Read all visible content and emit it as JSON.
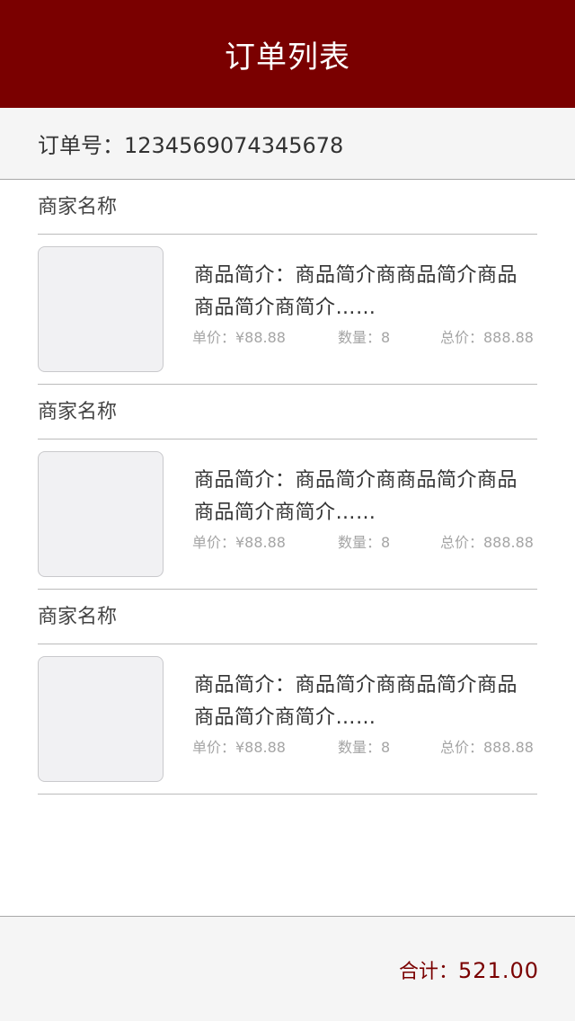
{
  "header": {
    "title": "订单列表"
  },
  "order": {
    "number_label": "订单号：1234569074345678"
  },
  "stores": [
    {
      "merchant_name": "商家名称",
      "description_line1": "商品简介：商品简介商商品简介商品",
      "description_line2": "商品简介商简介……",
      "unit_price": "单价：¥88.88",
      "quantity": "数量：8",
      "total_price": "总价：888.88"
    },
    {
      "merchant_name": "商家名称",
      "description_line1": "商品简介：商品简介商商品简介商品",
      "description_line2": "商品简介商简介……",
      "unit_price": "单价：¥88.88",
      "quantity": "数量：8",
      "total_price": "总价：888.88"
    },
    {
      "merchant_name": "商家名称",
      "description_line1": "商品简介：商品简介商商品简介商品",
      "description_line2": "商品简介商简介……",
      "unit_price": "单价：¥88.88",
      "quantity": "数量：8",
      "total_price": "总价：888.88"
    }
  ],
  "footer": {
    "total_label": "合计：",
    "total_amount": "521.00"
  },
  "colors": {
    "brand": "#7a0000",
    "panel": "#f5f5f5",
    "muted_text": "#a5a5a5"
  }
}
